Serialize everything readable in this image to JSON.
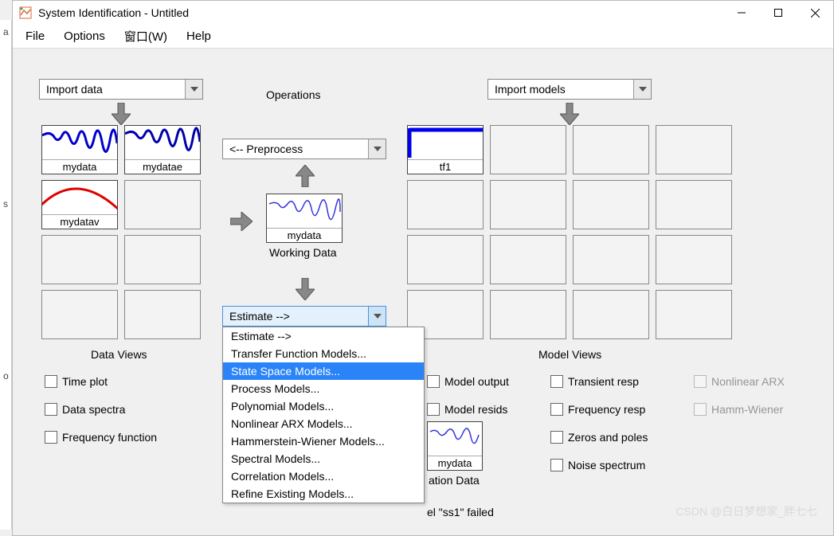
{
  "title": "System Identification - Untitled",
  "menu": {
    "file": "File",
    "options": "Options",
    "window": "窗口(W)",
    "help": "Help"
  },
  "import_data": "Import data",
  "import_models": "Import models",
  "operations_label": "Operations",
  "preprocess": "<-- Preprocess",
  "working_data_label": "Working Data",
  "estimate_label": "Estimate -->",
  "data_views_label": "Data Views",
  "model_views_label": "Model Views",
  "data_slots": {
    "s1": "mydata",
    "s2": "mydatae",
    "s3": "mydatav"
  },
  "working_data": "mydata",
  "model_slots": {
    "m1": "tf1"
  },
  "validation_thumb": "mydata",
  "validation_label": "ation Data",
  "status_line": "el \"ss1\" failed",
  "data_views": {
    "time": "Time plot",
    "spectra": "Data spectra",
    "freq": "Frequency function"
  },
  "model_views": {
    "output": "Model output",
    "resids": "Model resids",
    "transient": "Transient resp",
    "freq": "Frequency resp",
    "zeros": "Zeros and poles",
    "noise": "Noise spectrum",
    "narx": "Nonlinear ARX",
    "hw": "Hamm-Wiener"
  },
  "estimate_menu": [
    "Estimate -->",
    "Transfer Function Models...",
    "State Space Models...",
    "Process Models...",
    "Polynomial Models...",
    "Nonlinear ARX Models...",
    "Hammerstein-Wiener Models...",
    "Spectral Models...",
    "Correlation Models...",
    "Refine Existing Models..."
  ],
  "estimate_menu_selected": 2,
  "watermark": "CSDN @白日梦想家_胖七七"
}
